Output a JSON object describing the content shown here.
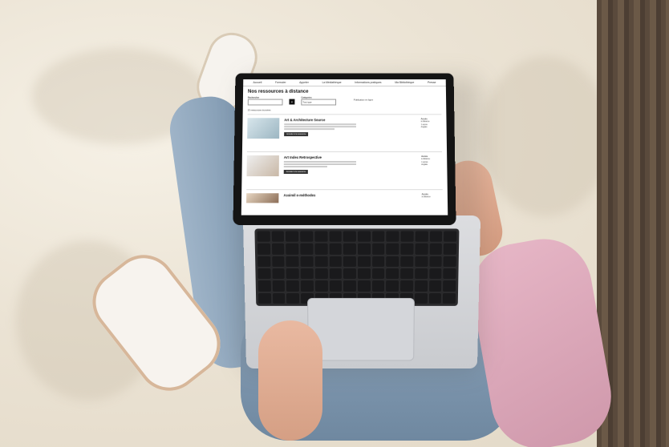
{
  "laptop_screen": {
    "nav": [
      "Accueil",
      "Formuler",
      "Appeler",
      "La Médiathèque",
      "Informations pratiques",
      "Ma Bibliothèque",
      "Presse"
    ],
    "page_title": "Nos ressources à distance",
    "search": {
      "keyword_label": "Rechercher",
      "category_label": "Catégories",
      "category_value": "Tout type",
      "side_link": "Publication en ligne"
    },
    "results_count": "15 ressources trouvées",
    "resources": [
      {
        "title": "Art & Architecture Source",
        "button": "Accéder à la ressource",
        "meta": [
          "Accès",
          "à distance",
          "1 accès",
          "Anglais"
        ]
      },
      {
        "title": "Art Index Retrospective",
        "button": "Accéder à la ressource",
        "meta": [
          "Accès",
          "à distance",
          "1 accès",
          "Anglais"
        ]
      },
      {
        "title": "Assimil e-méthodes",
        "button": "",
        "meta": [
          "Accès",
          "à distance"
        ]
      }
    ]
  },
  "icons": {
    "search_button": "search-icon"
  },
  "colors": {
    "bedsheet": "#efe9de",
    "jeans": "#7f98b0",
    "sleeve": "#d9a6b8",
    "laptop": "#cfd1d5"
  }
}
